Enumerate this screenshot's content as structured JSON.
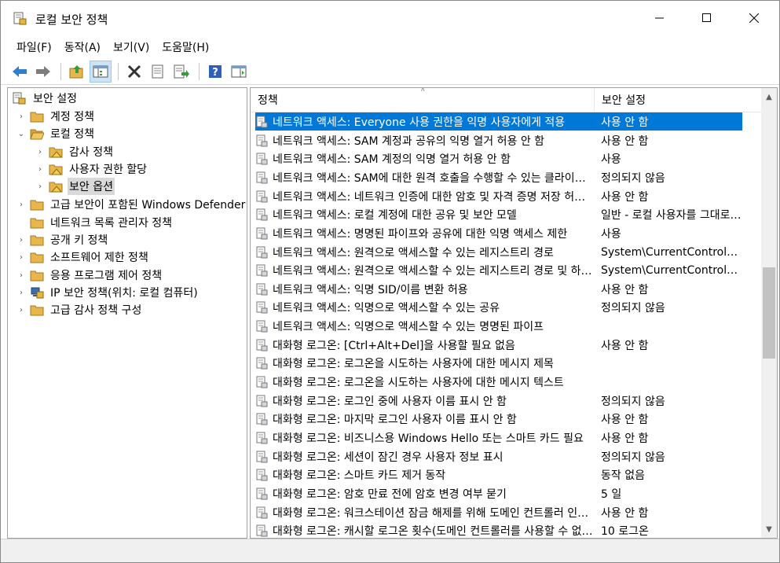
{
  "window": {
    "title": "로컬 보안 정책"
  },
  "menu": [
    "파일(F)",
    "동작(A)",
    "보기(V)",
    "도움말(H)"
  ],
  "toolbar": {
    "buttons": [
      "back-arrow-icon",
      "forward-arrow-icon",
      "up-folder-icon",
      "show-hide-tree-icon",
      "delete-icon",
      "properties-icon",
      "export-list-icon",
      "help-icon",
      "action-pane-icon"
    ]
  },
  "tree": {
    "items": [
      {
        "label": "보안 설정"
      },
      {
        "label": "계정 정책"
      },
      {
        "label": "로컬 정책"
      },
      {
        "label": "감사 정책"
      },
      {
        "label": "사용자 권한 할당"
      },
      {
        "label": "보안 옵션"
      },
      {
        "label": "고급 보안이 포함된 Windows Defender 방화벽"
      },
      {
        "label": "네트워크 목록 관리자 정책"
      },
      {
        "label": "공개 키 정책"
      },
      {
        "label": "소프트웨어 제한 정책"
      },
      {
        "label": "응용 프로그램 제어 정책"
      },
      {
        "label": "IP 보안 정책(위치: 로컬 컴퓨터)"
      },
      {
        "label": "고급 감사 정책 구성"
      }
    ]
  },
  "list": {
    "columns": [
      "정책",
      "보안 설정"
    ],
    "rows": [
      {
        "policy": "네트워크 액세스: Everyone 사용 권한을 익명 사용자에게 적용",
        "setting": "사용 안 함"
      },
      {
        "policy": "네트워크 액세스: SAM 계정과 공유의 익명 열거 허용 안 함",
        "setting": "사용 안 함"
      },
      {
        "policy": "네트워크 액세스: SAM 계정의 익명 열거 허용 안 함",
        "setting": "사용"
      },
      {
        "policy": "네트워크 액세스: SAM에 대한 원격 호출을 수행할 수 있는 클라이언트 제한",
        "setting": "정의되지 않음"
      },
      {
        "policy": "네트워크 액세스: 네트워크 인증에 대한 암호 및 자격 증명 저장 허용 안 함",
        "setting": "사용 안 함"
      },
      {
        "policy": "네트워크 액세스: 로컬 계정에 대한 공유 및 보안 모델",
        "setting": "일반 - 로컬 사용자를 그대로 인증"
      },
      {
        "policy": "네트워크 액세스: 명명된 파이프와 공유에 대한 익명 액세스 제한",
        "setting": "사용"
      },
      {
        "policy": "네트워크 액세스: 원격으로 액세스할 수 있는 레지스트리 경로",
        "setting": "System\\CurrentControlSet\\Control"
      },
      {
        "policy": "네트워크 액세스: 원격으로 액세스할 수 있는 레지스트리 경로 및 하위 경로",
        "setting": "System\\CurrentControlSet\\Control"
      },
      {
        "policy": "네트워크 액세스: 익명 SID/이름 변환 허용",
        "setting": "사용 안 함"
      },
      {
        "policy": "네트워크 액세스: 익명으로 액세스할 수 있는 공유",
        "setting": "정의되지 않음"
      },
      {
        "policy": "네트워크 액세스: 익명으로 액세스할 수 있는 명명된 파이프",
        "setting": ""
      },
      {
        "policy": "대화형 로그온: [Ctrl+Alt+Del]을 사용할 필요 없음",
        "setting": "사용 안 함"
      },
      {
        "policy": "대화형 로그온: 로그온을 시도하는 사용자에 대한 메시지 제목",
        "setting": ""
      },
      {
        "policy": "대화형 로그온: 로그온을 시도하는 사용자에 대한 메시지 텍스트",
        "setting": ""
      },
      {
        "policy": "대화형 로그온: 로그인 중에 사용자 이름 표시 안 함",
        "setting": "정의되지 않음"
      },
      {
        "policy": "대화형 로그온: 마지막 로그인 사용자 이름 표시 안 함",
        "setting": "사용 안 함"
      },
      {
        "policy": "대화형 로그온: 비즈니스용 Windows Hello 또는 스마트 카드 필요",
        "setting": "사용 안 함"
      },
      {
        "policy": "대화형 로그온: 세션이 잠긴 경우 사용자 정보 표시",
        "setting": "정의되지 않음"
      },
      {
        "policy": "대화형 로그온: 스마트 카드 제거 동작",
        "setting": "동작 없음"
      },
      {
        "policy": "대화형 로그온: 암호 만료 전에 암호 변경 여부 묻기",
        "setting": "5 일"
      },
      {
        "policy": "대화형 로그온: 워크스테이션 잠금 해제를 위해 도메인 컨트롤러 인증 필요",
        "setting": "사용 안 함"
      },
      {
        "policy": "대화형 로그온: 캐시할 로그온 횟수(도메인 컨트롤러를 사용할 수 없는 경우)",
        "setting": "10 로그온"
      }
    ]
  },
  "colors": {
    "selection": "#0078d7",
    "folder": "#e8b64c"
  }
}
